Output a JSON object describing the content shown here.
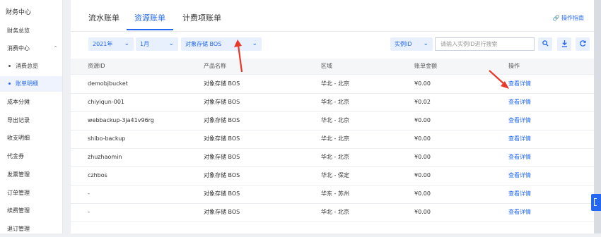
{
  "sidebar": {
    "title": "财务中心",
    "items": [
      {
        "label": "财务总览"
      },
      {
        "label": "消费中心"
      },
      {
        "label": "消费总览"
      },
      {
        "label": "账单明细"
      },
      {
        "label": "成本分摊"
      },
      {
        "label": "导出记录"
      },
      {
        "label": "收支明细"
      },
      {
        "label": "代金券"
      },
      {
        "label": "发票管理"
      },
      {
        "label": "订单管理"
      },
      {
        "label": "续费管理"
      },
      {
        "label": "退订管理"
      }
    ]
  },
  "tabs": [
    {
      "label": "流水账单"
    },
    {
      "label": "资源账单",
      "active": true
    },
    {
      "label": "计费项账单"
    }
  ],
  "guide_link": "操作指南",
  "filters": {
    "year": "2021年",
    "month": "1月",
    "product": "对象存储 BOS",
    "search_type": "实例ID",
    "search_placeholder": "请输入实例ID进行搜索"
  },
  "icons": {
    "search": "search-icon",
    "download": "download-icon",
    "refresh": "refresh-icon"
  },
  "table": {
    "headers": [
      "资源ID",
      "产品名称",
      "区域",
      "账单金额",
      "操作"
    ],
    "rows": [
      [
        "demobjbucket",
        "对象存储 BOS",
        "华北 - 北京",
        "¥0.00",
        "查看详情"
      ],
      [
        "chiyiqun-001",
        "对象存储 BOS",
        "华北 - 北京",
        "¥0.02",
        "查看详情"
      ],
      [
        "webbackup-3ja41v96rg",
        "对象存储 BOS",
        "华北 - 北京",
        "¥0.00",
        "查看详情"
      ],
      [
        "shibo-backup",
        "对象存储 BOS",
        "华北 - 北京",
        "¥0.00",
        "查看详情"
      ],
      [
        "zhuzhaomin",
        "对象存储 BOS",
        "华北 - 北京",
        "¥0.00",
        "查看详情"
      ],
      [
        "czhbos",
        "对象存储 BOS",
        "华北 - 保定",
        "¥0.00",
        "查看详情"
      ],
      [
        "-",
        "对象存储 BOS",
        "华东 - 苏州",
        "¥0.00",
        "查看详情"
      ],
      [
        "-",
        "对象存储 BOS",
        "华北 - 北京",
        "¥0.00",
        "查看详情"
      ]
    ]
  },
  "colors": {
    "accent": "#2468f2",
    "annotation_arrow": "#e8392b"
  }
}
